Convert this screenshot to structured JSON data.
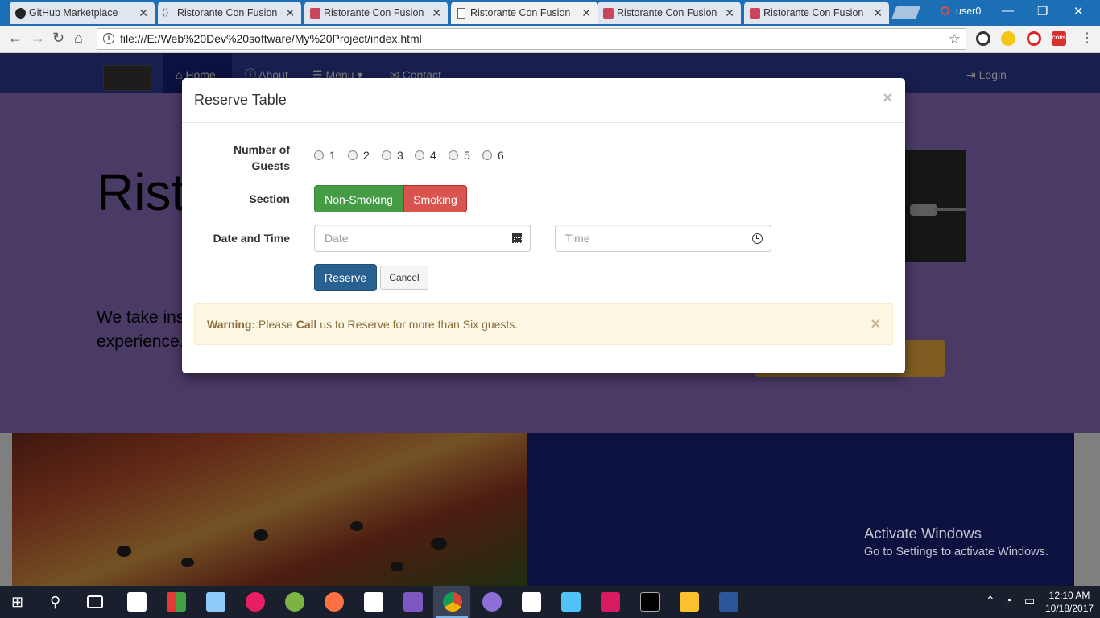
{
  "browser": {
    "tabs": [
      {
        "title": "GitHub Marketplace",
        "icon": "github-icon"
      },
      {
        "title": "Ristorante Con Fusion",
        "icon": "page-icon"
      },
      {
        "title": "Ristorante Con Fusion",
        "icon": "pdf-icon"
      },
      {
        "title": "Ristorante Con Fusion",
        "icon": "document-icon"
      },
      {
        "title": "Ristorante Con Fusion",
        "icon": "pdf-icon"
      },
      {
        "title": "Ristorante Con Fusion",
        "icon": "pdf-icon"
      }
    ],
    "active_tab": 3,
    "user": "user0",
    "url": "file:///E:/Web%20Dev%20software/My%20Project/index.html",
    "extension_labels": {
      "cors": "CORS"
    }
  },
  "site": {
    "nav": {
      "home": "Home",
      "about": "About",
      "menu": "Menu",
      "contact": "Contact",
      "login": "Login"
    },
    "jumbotron": {
      "title_partial": "Rist",
      "text_line1": "We take ins",
      "text_line2": "experience."
    }
  },
  "modal": {
    "title": "Reserve Table",
    "close_symbol": "×",
    "guests_label": "Number of Guests",
    "guest_options": [
      "1",
      "2",
      "3",
      "4",
      "5",
      "6"
    ],
    "section_label": "Section",
    "section_options": [
      "Non-Smoking",
      "Smoking"
    ],
    "datetime_label": "Date and Time",
    "date_placeholder": "Date",
    "time_placeholder": "Time",
    "reserve_button": "Reserve",
    "cancel_button": "Cancel",
    "alert": {
      "strong": "Warning:",
      "text1": ":Please ",
      "call": "Call",
      "text2": " us to Reserve for more than Six guests."
    }
  },
  "watermark": {
    "line1": "Activate Windows",
    "line2": "Go to Settings to activate Windows."
  },
  "taskbar": {
    "time": "12:10 AM",
    "date": "10/18/2017"
  },
  "colors": {
    "tabstrip": "#1d6fb5",
    "navbar": "#303f9f",
    "jumbotron": "#9575cd",
    "success": "#449d44",
    "danger": "#d9534f",
    "primary": "#286090",
    "warning_bg": "#fcf8e3"
  }
}
